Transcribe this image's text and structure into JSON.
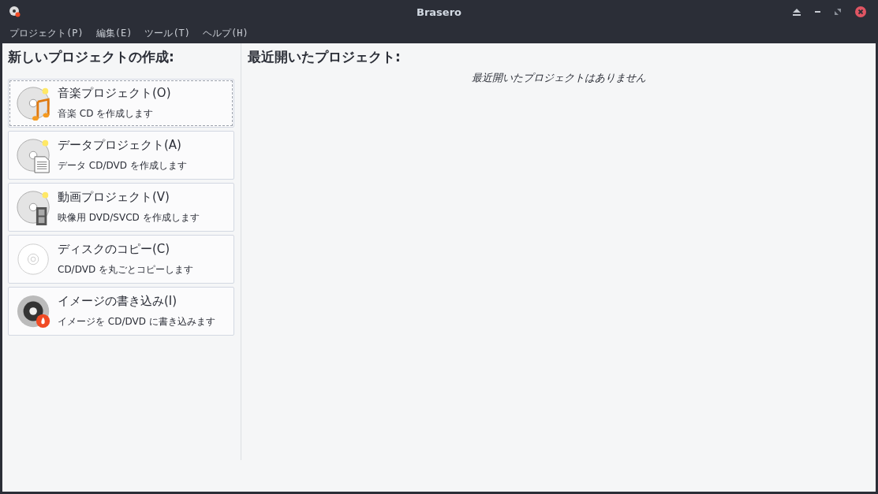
{
  "window": {
    "title": "Brasero"
  },
  "menu": [
    "プロジェクト(P)",
    "編集(E)",
    "ツール(T)",
    "ヘルプ(H)"
  ],
  "new_project": {
    "heading": "新しいプロジェクトの作成:",
    "items": [
      {
        "kind": "audio",
        "title": "音楽プロジェクト(O)",
        "description": "音楽 CD を作成します",
        "selected": true
      },
      {
        "kind": "data",
        "title": "データプロジェクト(A)",
        "description": "データ CD/DVD を作成します",
        "selected": false
      },
      {
        "kind": "video",
        "title": "動画プロジェクト(V)",
        "description": "映像用 DVD/SVCD を作成します",
        "selected": false
      },
      {
        "kind": "copy",
        "title": "ディスクのコピー(C)",
        "description": "CD/DVD を丸ごとコピーします",
        "selected": false
      },
      {
        "kind": "burn",
        "title": "イメージの書き込み(I)",
        "description": "イメージを CD/DVD に書き込みます",
        "selected": false
      }
    ]
  },
  "recent": {
    "heading": "最近開いたプロジェクト:",
    "empty_message": "最近開いたプロジェクトはありません"
  }
}
